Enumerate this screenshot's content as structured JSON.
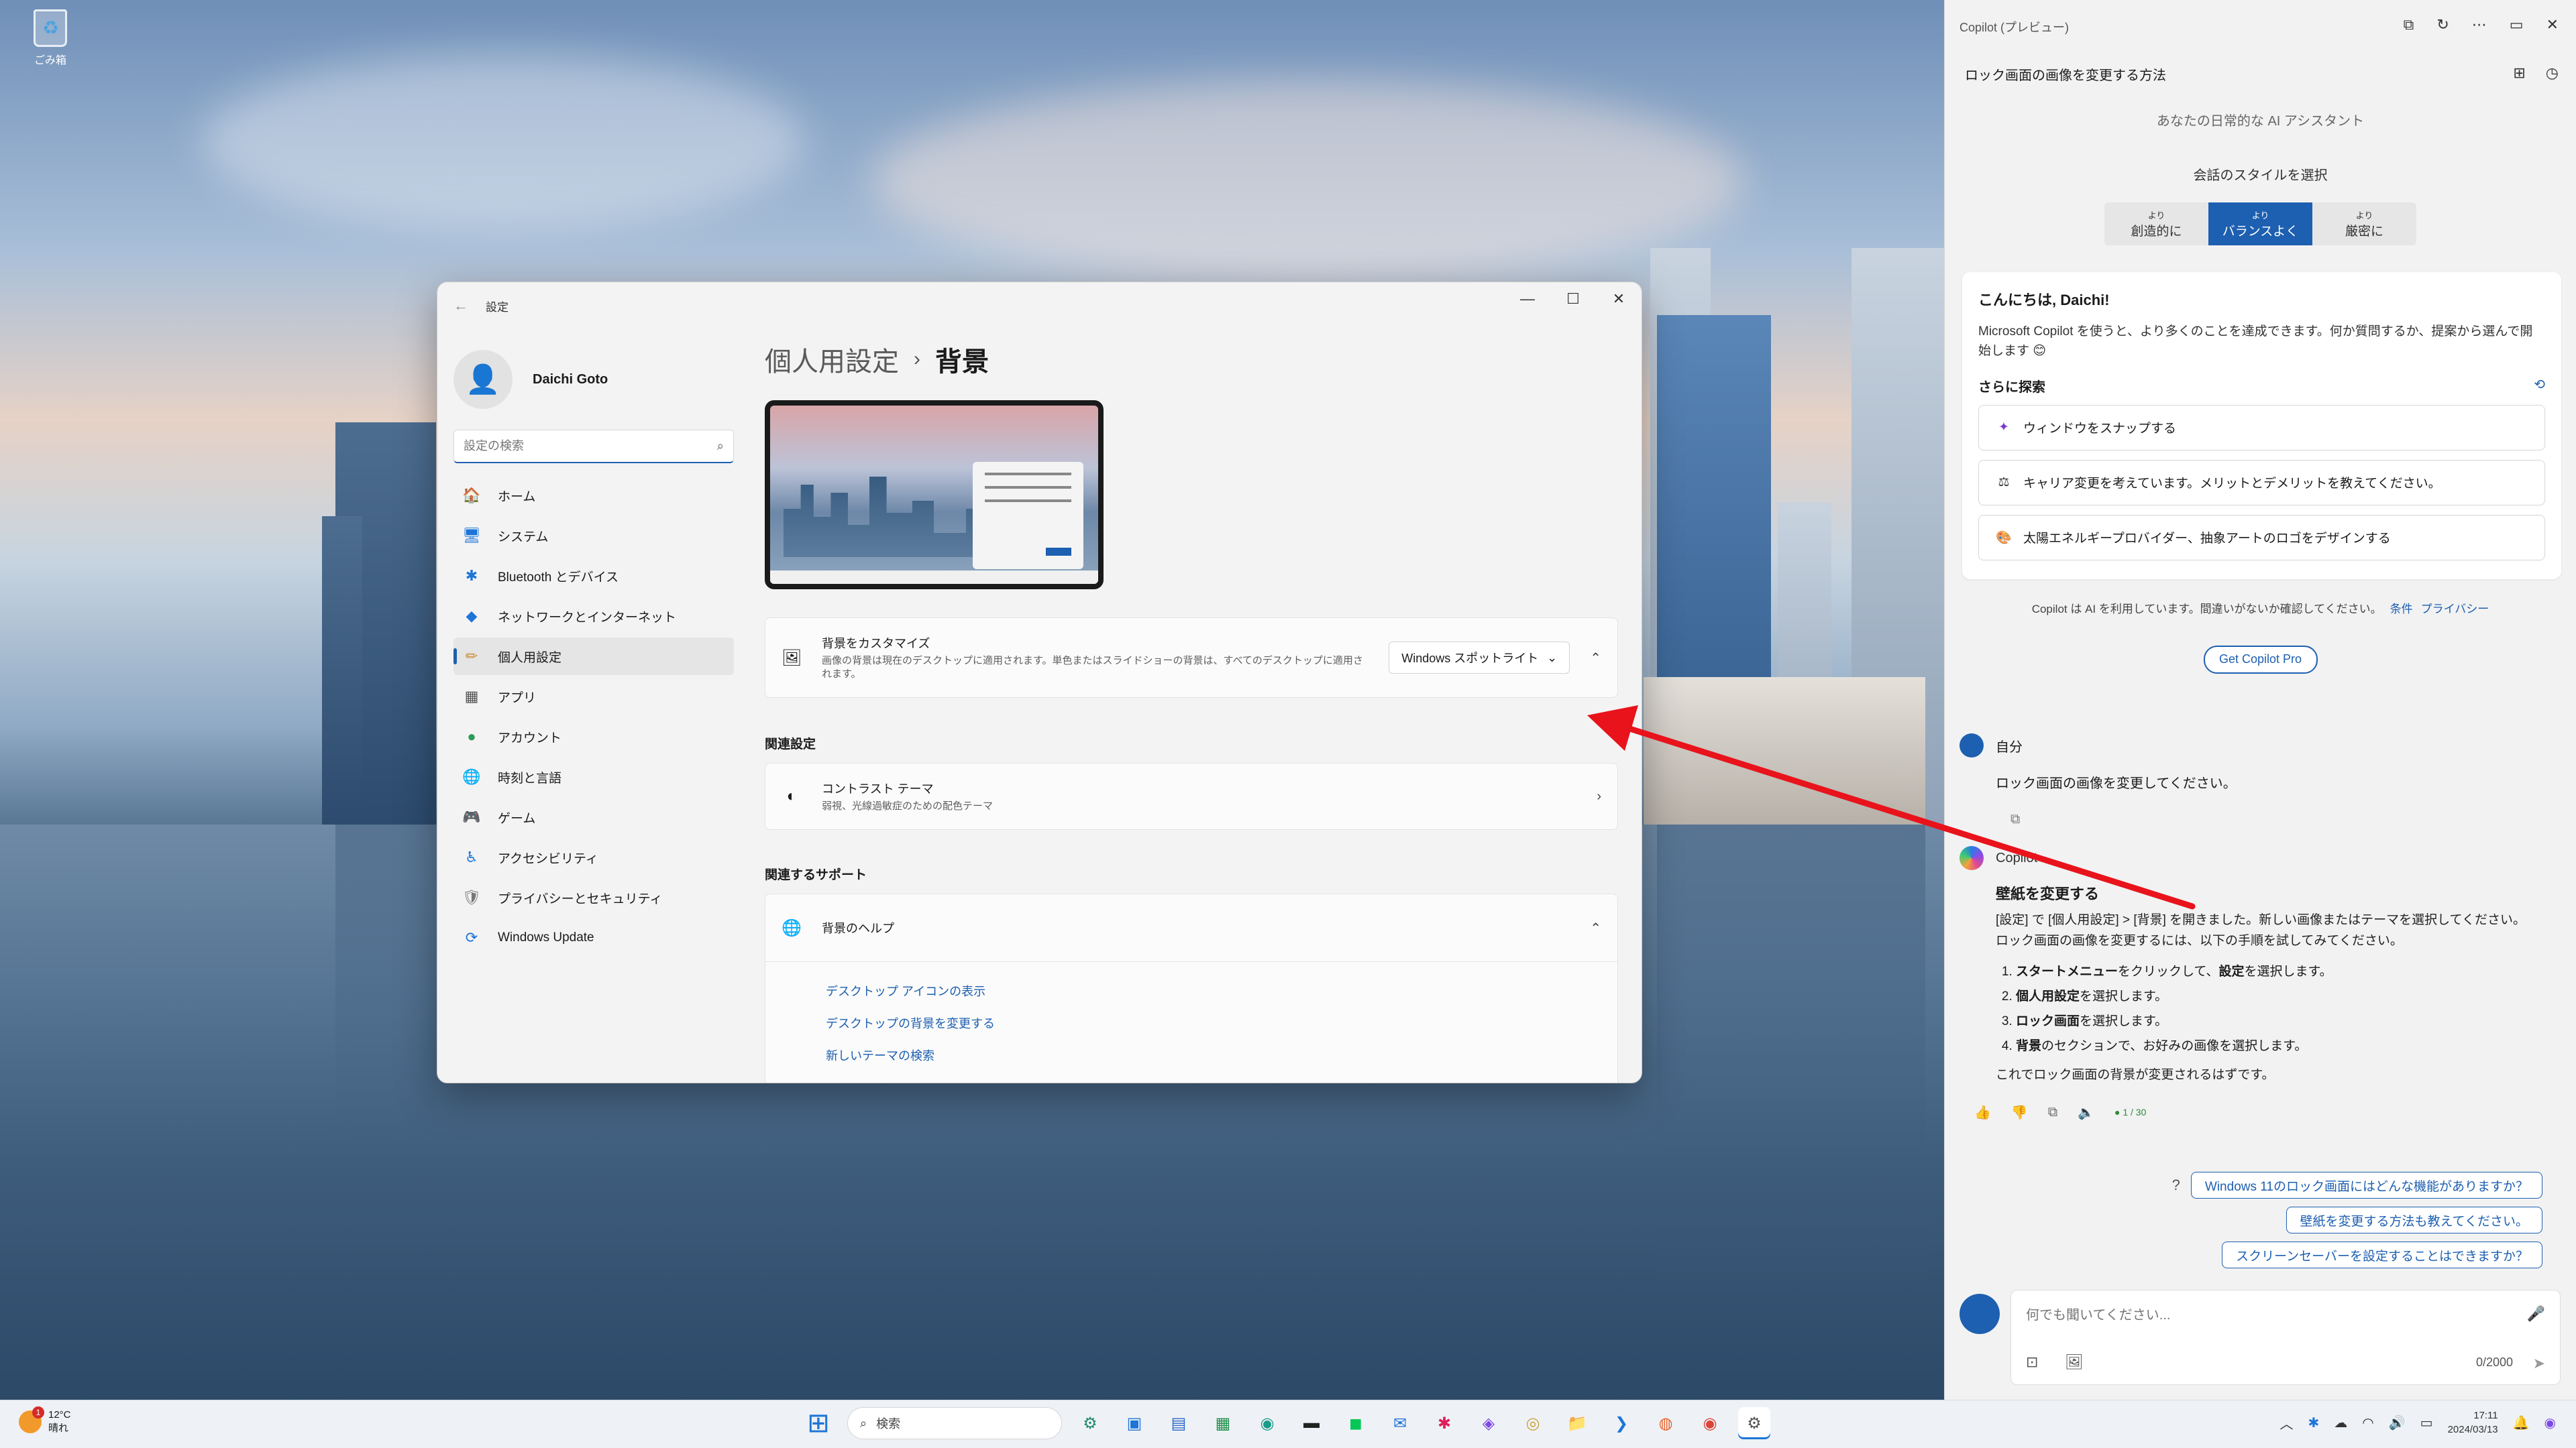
{
  "desktop": {
    "recycle_bin_label": "ごみ箱"
  },
  "settings": {
    "title": "設定",
    "controls": {
      "minimize": "—",
      "maximize": "☐",
      "close": "✕"
    },
    "user_name": "Daichi Goto",
    "search_placeholder": "設定の検索",
    "nav": [
      {
        "label": "ホーム",
        "icon": "🏠"
      },
      {
        "label": "システム",
        "icon": "🖥"
      },
      {
        "label": "Bluetooth とデバイス",
        "icon": "✱"
      },
      {
        "label": "ネットワークとインターネット",
        "icon": "◆"
      },
      {
        "label": "個人用設定",
        "icon": "✏"
      },
      {
        "label": "アプリ",
        "icon": "▦"
      },
      {
        "label": "アカウント",
        "icon": "●"
      },
      {
        "label": "時刻と言語",
        "icon": "🌐"
      },
      {
        "label": "ゲーム",
        "icon": "🎮"
      },
      {
        "label": "アクセシビリティ",
        "icon": "♿"
      },
      {
        "label": "プライバシーとセキュリティ",
        "icon": "🛡"
      },
      {
        "label": "Windows Update",
        "icon": "⟳"
      }
    ],
    "breadcrumb_parent": "個人用設定",
    "breadcrumb_sep": "›",
    "breadcrumb_current": "背景",
    "customize": {
      "title": "背景をカスタマイズ",
      "desc": "画像の背景は現在のデスクトップに適用されます。単色またはスライドショーの背景は、すべてのデスクトップに適用されます。",
      "value": "Windows スポットライト"
    },
    "related_title": "関連設定",
    "contrast": {
      "title": "コントラスト テーマ",
      "desc": "弱視、光線過敏症のための配色テーマ"
    },
    "support_title": "関連するサポート",
    "help": {
      "title": "背景のヘルプ"
    },
    "help_links": [
      "デスクトップ アイコンの表示",
      "デスクトップの背景を変更する",
      "新しいテーマの検索"
    ]
  },
  "copilot": {
    "title": "Copilot (プレビュー)",
    "topic": "ロック画面の画像を変更する方法",
    "subtitle": "あなたの日常的な AI アシスタント",
    "style_label": "会話のスタイルを選択",
    "styles": [
      {
        "small": "より",
        "label": "創造的に"
      },
      {
        "small": "より",
        "label": "バランスよく"
      },
      {
        "small": "より",
        "label": "厳密に"
      }
    ],
    "welcome_title": "こんにちは, Daichi!",
    "welcome_text": "Microsoft Copilot を使うと、より多くのことを達成できます。何か質問するか、提案から選んで開始します 😊",
    "explore_label": "さらに探索",
    "suggestions": [
      {
        "icon": "✦",
        "text": "ウィンドウをスナップする"
      },
      {
        "icon": "⚖",
        "text": "キャリア変更を考えています。メリットとデメリットを教えてください。"
      },
      {
        "icon": "🎨",
        "text": "太陽エネルギープロバイダー、抽象アートのロゴをデザインする"
      }
    ],
    "notice": "Copilot は AI を利用しています。間違いがないか確認してください。",
    "notice_terms": "条件",
    "notice_privacy": "プライバシー",
    "pro_button": "Get Copilot Pro",
    "user_label": "自分",
    "user_message": "ロック画面の画像を変更してください。",
    "bot_label": "Copilot",
    "bot_heading": "壁紙を変更する",
    "bot_p1": "[設定] で [個人用設定] > [背景] を開きました。新しい画像またはテーマを選択してください。",
    "bot_p2": "ロック画面の画像を変更するには、以下の手順を試してみてください。",
    "steps": [
      {
        "bold": "スタートメニュー",
        "mid": "をクリックして、",
        "bold2": "設定",
        "tail": "を選択します。"
      },
      {
        "bold": "個人用設定",
        "mid": "を選択します。",
        "bold2": "",
        "tail": ""
      },
      {
        "bold": "ロック画面",
        "mid": "を選択します。",
        "bold2": "",
        "tail": ""
      },
      {
        "bold": "背景",
        "mid": "のセクションで、お好みの画像を選択します。",
        "bold2": "",
        "tail": ""
      }
    ],
    "bot_p3": "これでロック画面の背景が変更されるはずです。",
    "response_count": "● 1 / 30",
    "followups": [
      "Windows 11のロック画面にはどんな機能がありますか？",
      "壁紙を変更する方法も教えてください。",
      "スクリーンセーバーを設定することはできますか？"
    ],
    "input_placeholder": "何でも聞いてください...",
    "char_count": "0/2000"
  },
  "taskbar": {
    "temp": "12°C",
    "weather": "晴れ",
    "weather_badge": "1",
    "search_label": "検索",
    "time": "17:11",
    "date": "2024/03/13"
  },
  "colors": {
    "accent": "#1d5fb0",
    "arrow": "#e8131b"
  }
}
